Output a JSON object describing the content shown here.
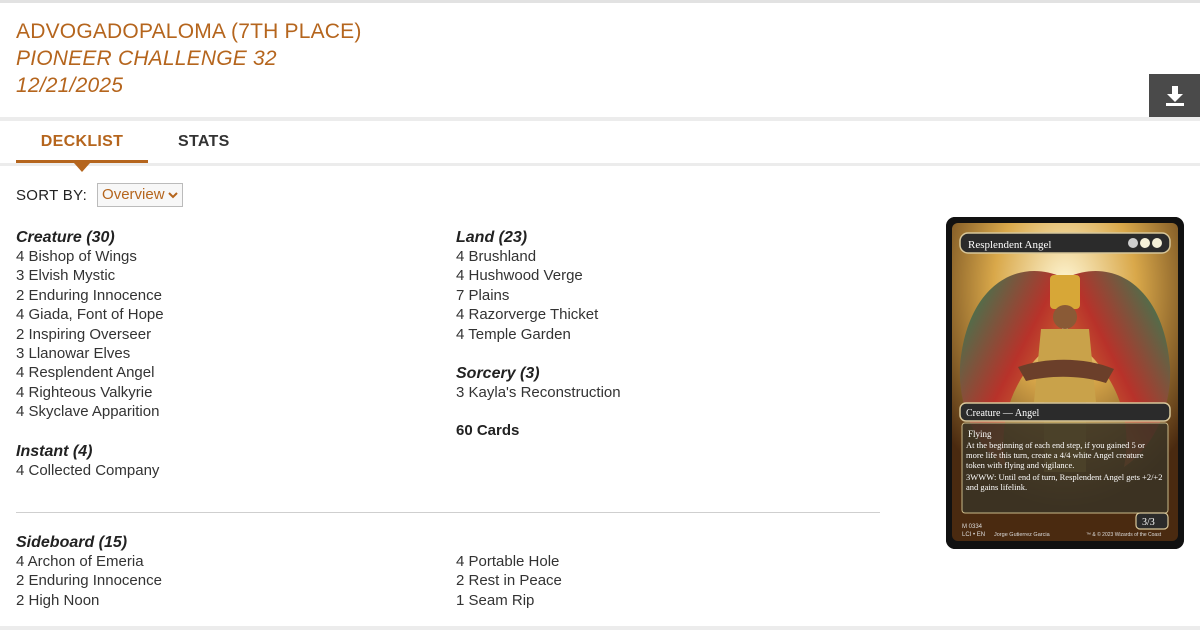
{
  "header": {
    "player": "ADVOGADOPALOMA (7TH PLACE)",
    "event": "PIONEER CHALLENGE 32",
    "date": "12/21/2025",
    "download_icon": "download-icon"
  },
  "tabs": [
    {
      "label": "DECKLIST",
      "active": true
    },
    {
      "label": "STATS",
      "active": false
    }
  ],
  "sort": {
    "label": "SORT BY:",
    "value": "Overview"
  },
  "mainboard": {
    "left": [
      {
        "heading": "Creature (30)",
        "cards": [
          "4 Bishop of Wings",
          "3 Elvish Mystic",
          "2 Enduring Innocence",
          "4 Giada, Font of Hope",
          "2 Inspiring Overseer",
          "3 Llanowar Elves",
          "4 Resplendent Angel",
          "4 Righteous Valkyrie",
          "4 Skyclave Apparition"
        ]
      },
      {
        "heading": "Instant (4)",
        "cards": [
          "4 Collected Company"
        ]
      }
    ],
    "right": [
      {
        "heading": "Land (23)",
        "cards": [
          "4 Brushland",
          "4 Hushwood Verge",
          "7 Plains",
          "4 Razorverge Thicket",
          "4 Temple Garden"
        ]
      },
      {
        "heading": "Sorcery (3)",
        "cards": [
          "3 Kayla's Reconstruction"
        ]
      }
    ],
    "total": "60 Cards"
  },
  "sideboard": {
    "heading": "Sideboard (15)",
    "left": [
      "4 Archon of Emeria",
      "2 Enduring Innocence",
      "2 High Noon"
    ],
    "right": [
      "4 Portable Hole",
      "2 Rest in Peace",
      "1 Seam Rip"
    ]
  },
  "card_image": {
    "name": "Resplendent Angel",
    "mana_cost": "1WW",
    "type_line": "Creature — Angel",
    "rules": [
      "Flying",
      "At the beginning of each end step, if you gained 5 or more life this turn, create a 4/4 white Angel creature token with flying and vigilance.",
      "3WWW: Until end of turn, Resplendent Angel gets +2/+2 and gains lifelink."
    ],
    "pt": "3/3",
    "collector": "M 0334",
    "set_line": "LCI • EN",
    "artist": "Jorge Gutierrez Garcia",
    "copyright": "™ & © 2023 Wizards of the Coast"
  },
  "colors": {
    "accent": "#b5651d",
    "dark_button": "#4a4a4a"
  }
}
